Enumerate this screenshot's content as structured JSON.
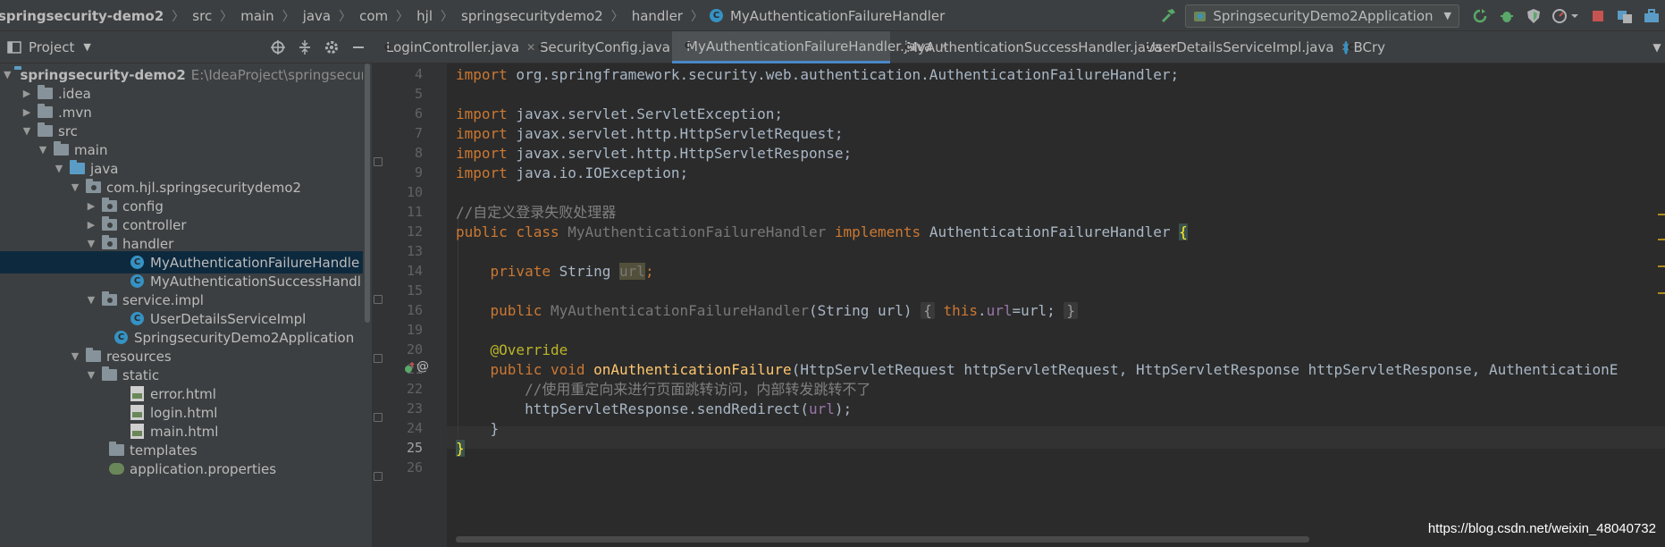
{
  "breadcrumb": {
    "items": [
      "springsecurity-demo2",
      "src",
      "main",
      "java",
      "com",
      "hjl",
      "springsecuritydemo2",
      "handler",
      "MyAuthenticationFailureHandler"
    ]
  },
  "run_config": {
    "label": "SpringsecurityDemo2Application"
  },
  "project_panel": {
    "title": "Project"
  },
  "tabs": [
    {
      "label": "LoginController.java",
      "active": false
    },
    {
      "label": "SecurityConfig.java",
      "active": false
    },
    {
      "label": "MyAuthenticationFailureHandler.java",
      "active": true
    },
    {
      "label": "MyAuthenticationSuccessHandler.java",
      "active": false
    },
    {
      "label": "UserDetailsServiceImpl.java",
      "active": false
    },
    {
      "label": "BCry",
      "active": false
    }
  ],
  "tree": {
    "root_label": "springsecurity-demo2",
    "root_path": "E:\\IdeaProject\\springsecur",
    "items": [
      ".idea",
      ".mvn",
      "src",
      "main",
      "java",
      "com.hjl.springsecuritydemo2",
      "config",
      "controller",
      "handler",
      "MyAuthenticationFailureHandle",
      "MyAuthenticationSuccessHandl",
      "service.impl",
      "UserDetailsServiceImpl",
      "SpringsecurityDemo2Application",
      "resources",
      "static",
      "error.html",
      "login.html",
      "main.html",
      "templates",
      "application.properties"
    ]
  },
  "editor": {
    "line_numbers": [
      "4",
      "5",
      "6",
      "7",
      "8",
      "9",
      "10",
      "11",
      "12",
      "13",
      "14",
      "15",
      "16",
      "19",
      "20",
      "21",
      "22",
      "23",
      "24",
      "25",
      "26"
    ],
    "lines": {
      "l4_kw": "import",
      "l4_rest": " org.springframework.security.web.authentication.AuthenticationFailureHandler;",
      "l6_kw": "import",
      "l6_rest": " javax.servlet.ServletException;",
      "l7_kw": "import",
      "l7_rest": " javax.servlet.http.HttpServletRequest;",
      "l8_kw": "import",
      "l8_rest": " javax.servlet.http.HttpServletResponse;",
      "l9_kw": "import",
      "l9_rest": " java.io.IOException;",
      "l11_comment": "//自定义登录失败处理器",
      "l12_kw1": "public class",
      "l12_cls": " MyAuthenticationFailureHandler",
      "l12_kw2": " implements",
      "l12_rest": " AuthenticationFailureHandler ",
      "l12_brace": "{",
      "l14_kw": "private",
      "l14_type": " String ",
      "l14_field": "url",
      "l14_semi": ";",
      "l16_kw": "public",
      "l16_cls": " MyAuthenticationFailureHandler",
      "l16_params": "(String url) ",
      "l16_open": "{",
      "l16_this": " this",
      "l16_dot": ".",
      "l16_field": "url",
      "l16_assign": "=url;",
      "l16_close": "}",
      "l20_ann": "@Override",
      "l21_kw": "public void",
      "l21_fn": " onAuthenticationFailure",
      "l21_params": "(HttpServletRequest httpServletRequest, HttpServletResponse httpServletResponse, AuthenticationE",
      "l22_comment": "//使用重定向来进行页面跳转访问，内部转发跳转不了",
      "l23_a": "httpServletResponse.sendRedirect(",
      "l23_field": "url",
      "l23_b": ");",
      "l24": "}",
      "l25": "}"
    }
  },
  "watermark": "https://blog.csdn.net/weixin_48040732",
  "colors": {
    "keyword": "#cc7832",
    "function": "#ffc66d",
    "field": "#9876aa",
    "annotation": "#bbb529",
    "comment": "#808080",
    "accent": "#4a88c7"
  }
}
